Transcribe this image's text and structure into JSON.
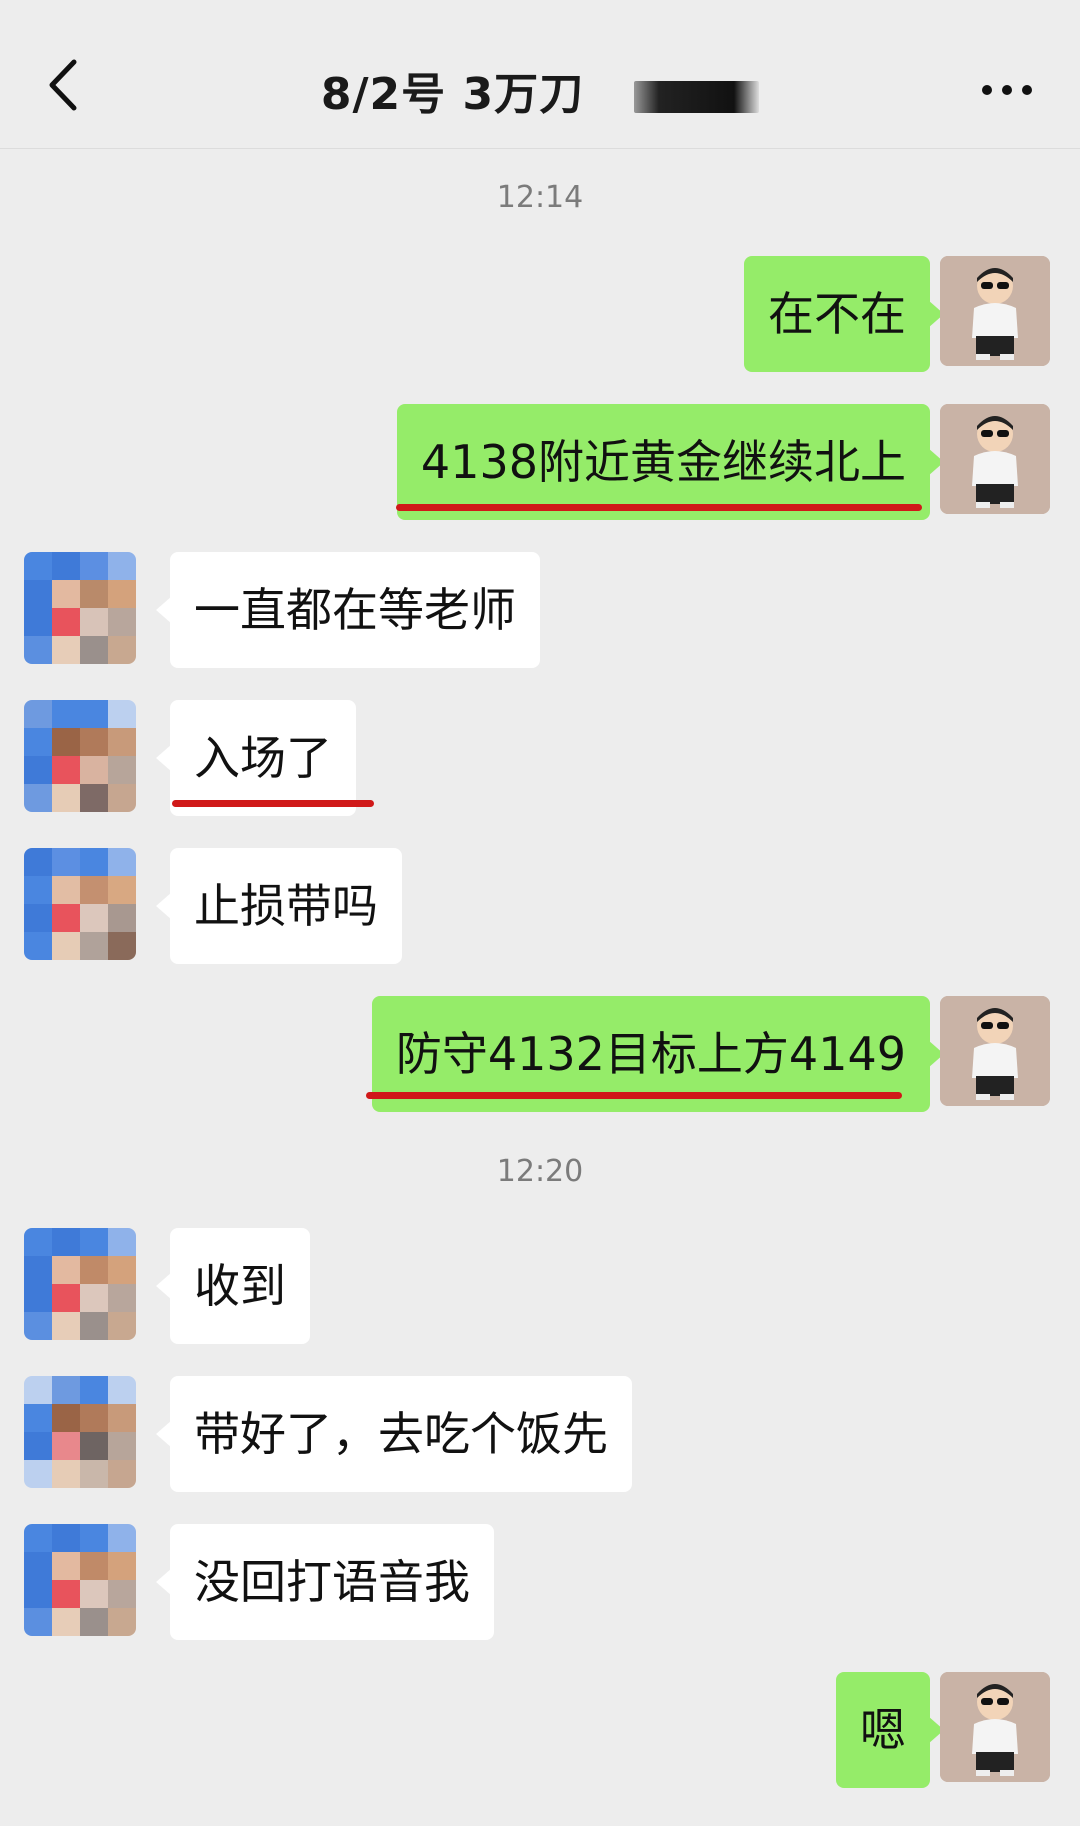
{
  "header": {
    "title": "8/2号  3万刀",
    "back_icon": "chevron-left-icon",
    "more_icon": "more-dots-icon"
  },
  "timestamps": [
    "12:14",
    "12:20"
  ],
  "messages": [
    {
      "side": "me",
      "text": "在不在"
    },
    {
      "side": "me",
      "text": "4138附近黄金继续北上",
      "underlined": true
    },
    {
      "side": "them",
      "text": "一直都在等老师"
    },
    {
      "side": "them",
      "text": "入场了",
      "underlined": true
    },
    {
      "side": "them",
      "text": "止损带吗"
    },
    {
      "side": "me",
      "text": "防守4132目标上方4149",
      "underlined": true
    },
    {
      "side": "them",
      "text": "收到"
    },
    {
      "side": "them",
      "text": "带好了，去吃个饭先"
    },
    {
      "side": "them",
      "text": "没回打语音我"
    },
    {
      "side": "me",
      "text": "嗯"
    }
  ],
  "colors": {
    "background": "#ededed",
    "my_bubble": "#95ec69",
    "their_bubble": "#ffffff",
    "underline": "#d01919"
  }
}
